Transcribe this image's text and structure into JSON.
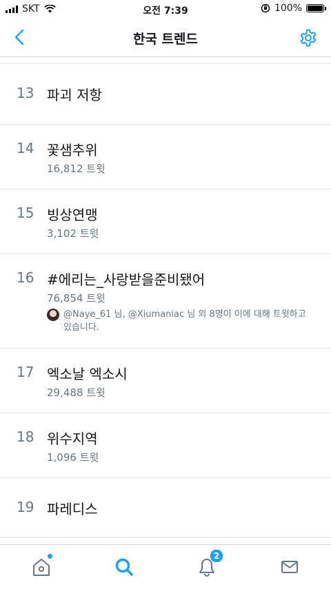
{
  "status_bar": {
    "carrier": "SKT",
    "time": "오전 7:39",
    "battery": "100%"
  },
  "nav": {
    "title": "한국 트렌드"
  },
  "trends": [
    {
      "rank": "13",
      "name": "파괴 저항",
      "count": "",
      "context": ""
    },
    {
      "rank": "14",
      "name": "꽃샘추위",
      "count": "16,812 트윗",
      "context": ""
    },
    {
      "rank": "15",
      "name": "빙상연맹",
      "count": "3,102 트윗",
      "context": ""
    },
    {
      "rank": "16",
      "name": "#에리는_사랑받을준비됐어",
      "count": "76,854 트윗",
      "context": "@Naye_61 님, @Xiumaniac 님 외 8명이 이에 대해 트윗하고 있습니다."
    },
    {
      "rank": "17",
      "name": "엑소날 엑소시",
      "count": "29,488 트윗",
      "context": ""
    },
    {
      "rank": "18",
      "name": "위수지역",
      "count": "1,096 트윗",
      "context": ""
    },
    {
      "rank": "19",
      "name": "파레디스",
      "count": "",
      "context": ""
    }
  ],
  "tab_bar": {
    "notifications_badge": "2",
    "accent": "#1da1f2"
  }
}
